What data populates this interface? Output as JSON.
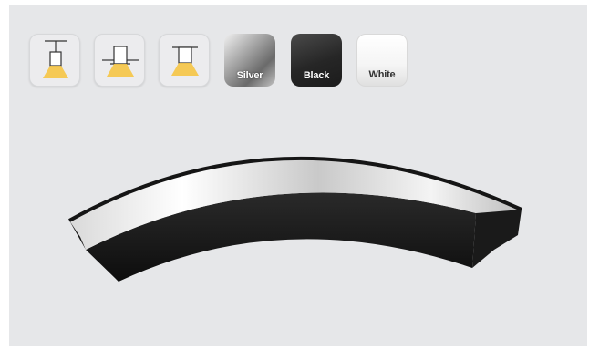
{
  "mount_options": [
    {
      "icon": "pendant-mount-icon"
    },
    {
      "icon": "recessed-mount-icon"
    },
    {
      "icon": "surface-mount-icon"
    }
  ],
  "finish_options": [
    {
      "label": "Silver",
      "color": "#9a9a9a"
    },
    {
      "label": "Black",
      "color": "#262626"
    },
    {
      "label": "White",
      "color": "#ffffff"
    }
  ],
  "colors": {
    "panel_background": "#e6e7e9",
    "light_glow": "#f6c544"
  }
}
